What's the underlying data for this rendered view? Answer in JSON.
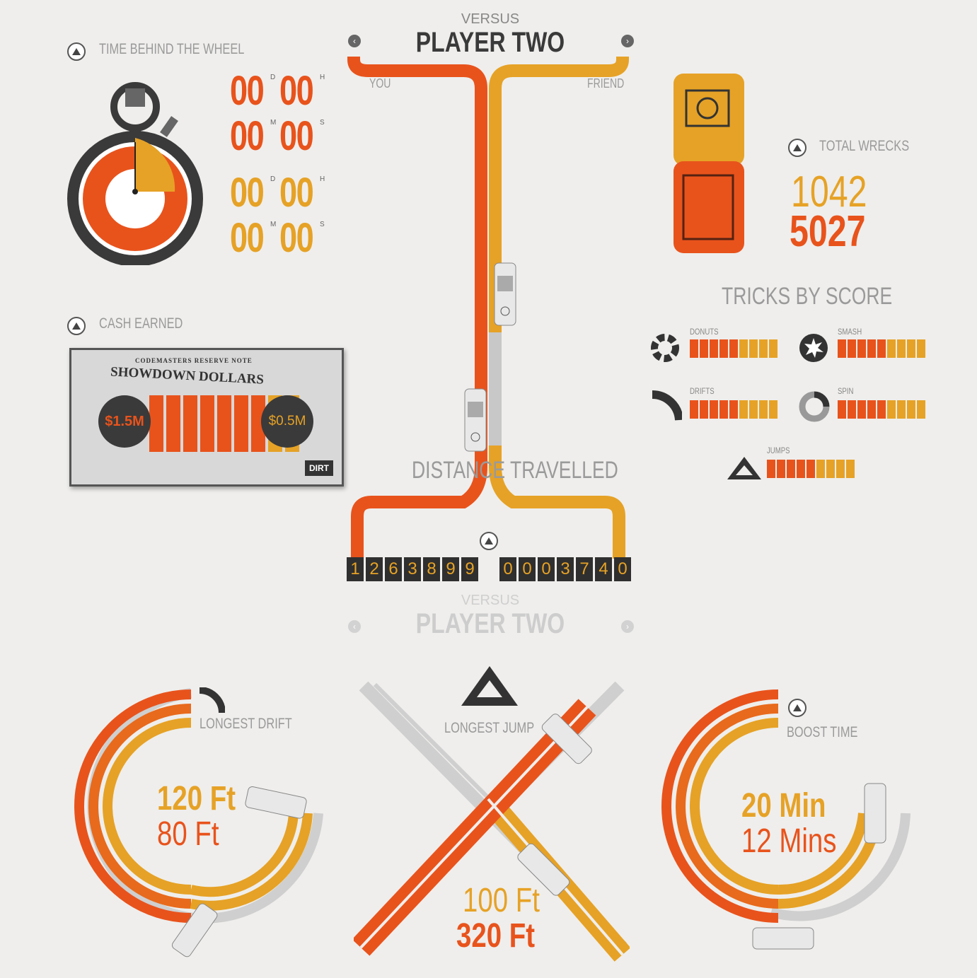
{
  "header": {
    "versus": "VERSUS",
    "title": "PLAYER TWO",
    "you": "YOU",
    "friend": "FRIEND"
  },
  "time": {
    "label": "TIME BEHIND THE WHEEL",
    "you": {
      "d": "00",
      "h": "00",
      "m": "00",
      "s": "00"
    },
    "friend": {
      "d": "00",
      "h": "00",
      "m": "00",
      "s": "00"
    },
    "units": {
      "d": "D",
      "h": "H",
      "m": "M",
      "s": "S"
    }
  },
  "cash": {
    "label": "CASH EARNED",
    "note_header": "CODEMASTERS RESERVE NOTE",
    "note_title": "SHOWDOWN DOLLARS",
    "you": "$1.5M",
    "friend": "$0.5M",
    "brand": "DIRT",
    "share_you": 0.75
  },
  "wrecks": {
    "label": "TOTAL WRECKS",
    "friend": "1042",
    "you": "5027"
  },
  "tricks": {
    "title": "TRICKS BY SCORE",
    "items": [
      {
        "name": "DONUTS",
        "icon": "donut-icon"
      },
      {
        "name": "SMASH",
        "icon": "smash-icon"
      },
      {
        "name": "DRIFTS",
        "icon": "drift-icon"
      },
      {
        "name": "SPIN",
        "icon": "spin-icon"
      },
      {
        "name": "JUMPS",
        "icon": "jump-icon"
      }
    ],
    "segments_orange": 5,
    "segments_yellow": 4
  },
  "distance": {
    "label": "DISTANCE TRAVELLED",
    "you_digits": [
      "1",
      "2",
      "6",
      "3",
      "8",
      "9",
      "9"
    ],
    "friend_digits": [
      "0",
      "0",
      "0",
      "3",
      "7",
      "4",
      "0"
    ]
  },
  "header2": {
    "versus": "VERSUS",
    "title": "PLAYER TWO"
  },
  "drift": {
    "label": "LONGEST DRIFT",
    "you": "120 Ft",
    "friend": "80 Ft"
  },
  "jump": {
    "label": "LONGEST JUMP",
    "friend": "100 Ft",
    "you": "320 Ft"
  },
  "boost": {
    "label": "BOOST TIME",
    "you": "20 Min",
    "friend": "12 Mins"
  },
  "colors": {
    "orange": "#e8531c",
    "orange_dark": "#d8401a",
    "yellow": "#e6a226",
    "grey": "#c8c8c8",
    "dark": "#3a3a3a"
  }
}
